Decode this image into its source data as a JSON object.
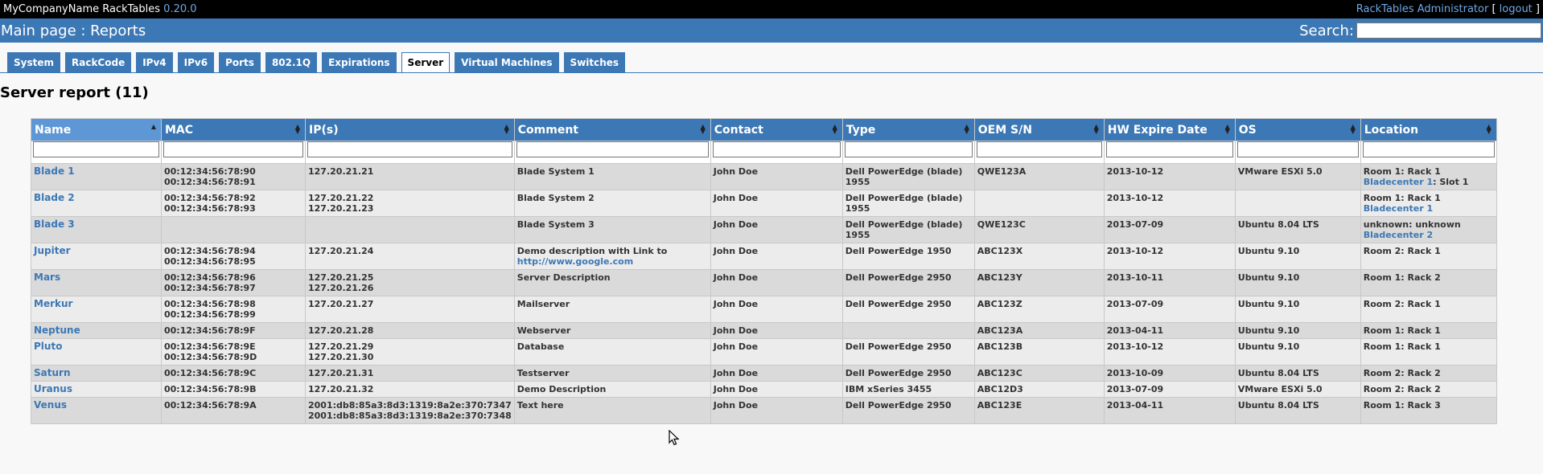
{
  "header": {
    "company": "MyCompanyName RackTables",
    "version": "0.20.0",
    "user": "RackTables Administrator",
    "logout": "logout",
    "bracket_open": "[",
    "bracket_close": "]"
  },
  "pathbar": {
    "path": "Main page : Reports",
    "search_label": "Search:",
    "search_value": ""
  },
  "tabs": [
    {
      "label": "System"
    },
    {
      "label": "RackCode"
    },
    {
      "label": "IPv4"
    },
    {
      "label": "IPv6"
    },
    {
      "label": "Ports"
    },
    {
      "label": "802.1Q"
    },
    {
      "label": "Expirations"
    },
    {
      "label": "Server",
      "active": true
    },
    {
      "label": "Virtual Machines"
    },
    {
      "label": "Switches"
    }
  ],
  "report": {
    "title": "Server report (11)",
    "columns": [
      "Name",
      "MAC",
      "IP(s)",
      "Comment",
      "Contact",
      "Type",
      "OEM S/N",
      "HW Expire Date",
      "OS",
      "Location"
    ],
    "sorted_column": "Name",
    "rows": [
      {
        "name": "Blade 1",
        "mac": [
          "00:12:34:56:78:90",
          "00:12:34:56:78:91"
        ],
        "ips": [
          "127.20.21.21"
        ],
        "comment": [
          "Blade System 1"
        ],
        "contact": "John Doe",
        "type": "Dell PowerEdge (blade) 1955",
        "oem": "QWE123A",
        "expire": "2013-10-12",
        "os": "VMware ESXi 5.0",
        "location": [
          {
            "text": "Room 1: Rack 1"
          },
          {
            "link": "Bladecenter 1",
            "text": ": Slot 1"
          }
        ]
      },
      {
        "name": "Blade 2",
        "mac": [
          "00:12:34:56:78:92",
          "00:12:34:56:78:93"
        ],
        "ips": [
          "127.20.21.22",
          "127.20.21.23"
        ],
        "comment": [
          "Blade System 2"
        ],
        "contact": "John Doe",
        "type": "Dell PowerEdge (blade) 1955",
        "oem": "",
        "expire": "2013-10-12",
        "os": "",
        "location": [
          {
            "text": "Room 1: Rack 1"
          },
          {
            "link": "Bladecenter 1",
            "text": ""
          }
        ]
      },
      {
        "name": "Blade 3",
        "mac": [],
        "ips": [],
        "comment": [
          "Blade System 3"
        ],
        "contact": "John Doe",
        "type": "Dell PowerEdge (blade) 1955",
        "oem": "QWE123C",
        "expire": "2013-07-09",
        "os": "Ubuntu 8.04 LTS",
        "location": [
          {
            "text": "unknown: unknown"
          },
          {
            "link": "Bladecenter 2",
            "text": ""
          }
        ]
      },
      {
        "name": "Jupiter",
        "mac": [
          "00:12:34:56:78:94",
          "00:12:34:56:78:95"
        ],
        "ips": [
          "127.20.21.24"
        ],
        "comment": [
          "Demo description with Link to"
        ],
        "comment_link": "http://www.google.com",
        "contact": "John Doe",
        "type": "Dell PowerEdge 1950",
        "oem": "ABC123X",
        "expire": "2013-10-12",
        "os": "Ubuntu 9.10",
        "location": [
          {
            "text": "Room 2: Rack 1"
          }
        ]
      },
      {
        "name": "Mars",
        "mac": [
          "00:12:34:56:78:96",
          "00:12:34:56:78:97"
        ],
        "ips": [
          "127.20.21.25",
          "127.20.21.26"
        ],
        "comment": [
          "Server Description"
        ],
        "contact": "John Doe",
        "type": "Dell PowerEdge 2950",
        "oem": "ABC123Y",
        "expire": "2013-10-11",
        "os": "Ubuntu 9.10",
        "location": [
          {
            "text": "Room 1: Rack 2"
          }
        ]
      },
      {
        "name": "Merkur",
        "mac": [
          "00:12:34:56:78:98",
          "00:12:34:56:78:99"
        ],
        "ips": [
          "127.20.21.27"
        ],
        "comment": [
          "Mailserver"
        ],
        "contact": "John Doe",
        "type": "Dell PowerEdge 2950",
        "oem": "ABC123Z",
        "expire": "2013-07-09",
        "os": "Ubuntu 9.10",
        "location": [
          {
            "text": "Room 2: Rack 1"
          }
        ]
      },
      {
        "name": "Neptune",
        "mac": [
          "00:12:34:56:78:9F"
        ],
        "ips": [
          "127.20.21.28"
        ],
        "comment": [
          "Webserver"
        ],
        "contact": "John Doe",
        "type": "",
        "oem": "ABC123A",
        "expire": "2013-04-11",
        "os": "Ubuntu 9.10",
        "location": [
          {
            "text": "Room 1: Rack 1"
          }
        ]
      },
      {
        "name": "Pluto",
        "mac": [
          "00:12:34:56:78:9E",
          "00:12:34:56:78:9D"
        ],
        "ips": [
          "127.20.21.29",
          "127.20.21.30"
        ],
        "comment": [
          "Database"
        ],
        "contact": "John Doe",
        "type": "Dell PowerEdge 2950",
        "oem": "ABC123B",
        "expire": "2013-10-12",
        "os": "Ubuntu 9.10",
        "location": [
          {
            "text": "Room 1: Rack 1"
          }
        ]
      },
      {
        "name": "Saturn",
        "mac": [
          "00:12:34:56:78:9C"
        ],
        "ips": [
          "127.20.21.31"
        ],
        "comment": [
          "Testserver"
        ],
        "contact": "John Doe",
        "type": "Dell PowerEdge 2950",
        "oem": "ABC123C",
        "expire": "2013-10-09",
        "os": "Ubuntu 8.04 LTS",
        "location": [
          {
            "text": "Room 2: Rack 2"
          }
        ]
      },
      {
        "name": "Uranus",
        "mac": [
          "00:12:34:56:78:9B"
        ],
        "ips": [
          "127.20.21.32"
        ],
        "comment": [
          "Demo Description"
        ],
        "contact": "John Doe",
        "type": "IBM xSeries 3455",
        "oem": "ABC12D3",
        "expire": "2013-07-09",
        "os": "VMware ESXi 5.0",
        "location": [
          {
            "text": "Room 2: Rack 2"
          }
        ]
      },
      {
        "name": "Venus",
        "mac": [
          "00:12:34:56:78:9A"
        ],
        "ips": [
          "2001:db8:85a3:8d3:1319:8a2e:370:7347",
          "2001:db8:85a3:8d3:1319:8a2e:370:7348"
        ],
        "comment": [
          "Text here"
        ],
        "contact": "John Doe",
        "type": "Dell PowerEdge 2950",
        "oem": "ABC123E",
        "expire": "2013-04-11",
        "os": "Ubuntu 8.04 LTS",
        "location": [
          {
            "text": "Room 1: Rack 3"
          }
        ]
      }
    ]
  },
  "colors": {
    "header_blue": "#3c78b5",
    "link_blue": "#3c78b5",
    "row_odd": "#dadada",
    "row_even": "#ececec"
  }
}
